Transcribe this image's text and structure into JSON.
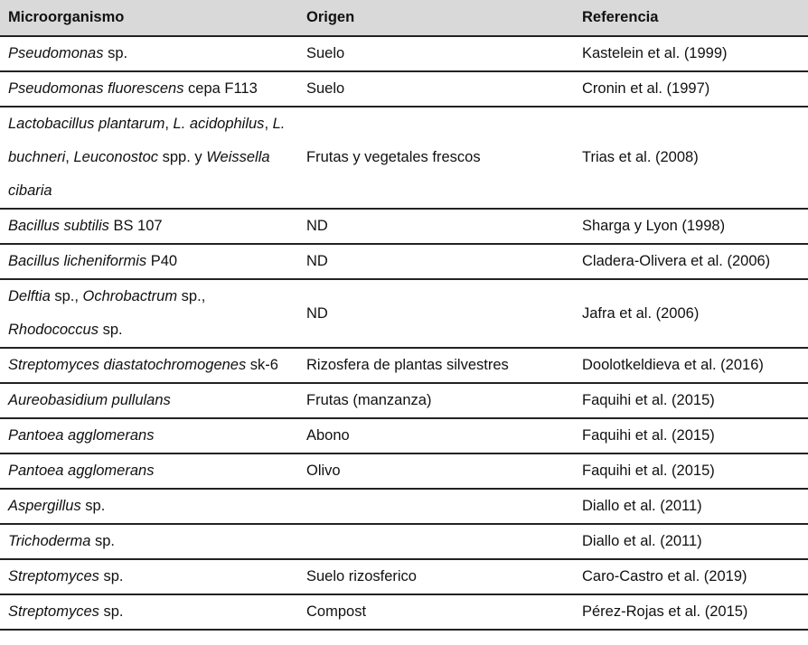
{
  "table": {
    "headers": [
      "Microorganismo",
      "Origen",
      "Referencia"
    ],
    "rows": [
      {
        "organism": [
          {
            "t": "Pseudomonas",
            "i": true
          },
          {
            "t": " sp.",
            "i": false
          }
        ],
        "origin": "Suelo",
        "reference": "Kastelein et al. (1999)"
      },
      {
        "organism": [
          {
            "t": "Pseudomonas fluorescens",
            "i": true
          },
          {
            "t": " cepa F113",
            "i": false
          }
        ],
        "origin": "Suelo",
        "reference": "Cronin et al. (1997)"
      },
      {
        "organism": [
          {
            "t": "Lactobacillus plantarum",
            "i": true
          },
          {
            "t": ", ",
            "i": false
          },
          {
            "t": "L. acidophilus",
            "i": true
          },
          {
            "t": ", ",
            "i": false
          },
          {
            "t": "L. buchneri",
            "i": true
          },
          {
            "t": ", ",
            "i": false
          },
          {
            "t": "Leuconostoc",
            "i": true
          },
          {
            "t": " spp. y ",
            "i": false
          },
          {
            "t": "Weissella cibaria",
            "i": true
          }
        ],
        "origin": "Frutas y vegetales frescos",
        "reference": "Trias et al. (2008)"
      },
      {
        "organism": [
          {
            "t": "Bacillus subtilis",
            "i": true
          },
          {
            "t": " BS 107",
            "i": false
          }
        ],
        "origin": "ND",
        "reference": "Sharga y Lyon (1998)"
      },
      {
        "organism": [
          {
            "t": "Bacillus licheniformis",
            "i": true
          },
          {
            "t": " P40",
            "i": false
          }
        ],
        "origin": "ND",
        "reference": "Cladera-Olivera et al. (2006)"
      },
      {
        "organism": [
          {
            "t": "Delftia",
            "i": true
          },
          {
            "t": " sp., ",
            "i": false
          },
          {
            "t": "Ochrobactrum",
            "i": true
          },
          {
            "t": " sp., ",
            "i": false
          },
          {
            "t": "Rhodococcus",
            "i": true
          },
          {
            "t": " sp.",
            "i": false
          }
        ],
        "origin": "ND",
        "reference": "Jafra et al. (2006)"
      },
      {
        "organism": [
          {
            "t": "Streptomyces diastatochromogenes",
            "i": true
          },
          {
            "t": " sk-6",
            "i": false
          }
        ],
        "origin": "Rizosfera de plantas silvestres",
        "reference": "Doolotkeldieva et al. (2016)"
      },
      {
        "organism": [
          {
            "t": "Aureobasidium pullulans",
            "i": true
          }
        ],
        "origin": "Frutas (manzanza)",
        "reference": "Faquihi et al. (2015)"
      },
      {
        "organism": [
          {
            "t": "Pantoea agglomerans",
            "i": true
          }
        ],
        "origin": "Abono",
        "reference": "Faquihi et al. (2015)"
      },
      {
        "organism": [
          {
            "t": "Pantoea agglomerans",
            "i": true
          }
        ],
        "origin": "Olivo",
        "reference": "Faquihi et al. (2015)"
      },
      {
        "organism": [
          {
            "t": "Aspergillus",
            "i": true
          },
          {
            "t": " sp.",
            "i": false
          }
        ],
        "origin": "",
        "reference": "Diallo et al. (2011)"
      },
      {
        "organism": [
          {
            "t": "Trichoderma",
            "i": true
          },
          {
            "t": " sp.",
            "i": false
          }
        ],
        "origin": "",
        "reference": "Diallo et al. (2011)"
      },
      {
        "organism": [
          {
            "t": "Streptomyces",
            "i": true
          },
          {
            "t": " sp.",
            "i": false
          }
        ],
        "origin": "Suelo rizosferico",
        "reference": "Caro-Castro et al. (2019)"
      },
      {
        "organism": [
          {
            "t": "Streptomyces",
            "i": true
          },
          {
            "t": " sp.",
            "i": false
          }
        ],
        "origin": "Compost",
        "reference": "Pérez-Rojas et al. (2015)"
      }
    ]
  }
}
